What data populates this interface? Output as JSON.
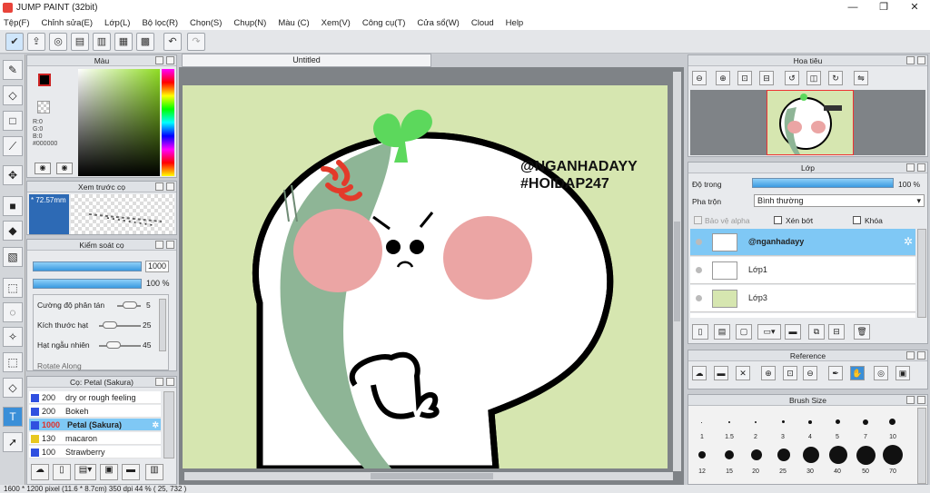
{
  "window": {
    "title": "JUMP PAINT (32bit)",
    "minimize": "—",
    "maximize": "❐",
    "close": "✕"
  },
  "menu": [
    "Tệp(F)",
    "Chỉnh sửa(E)",
    "Lớp(L)",
    "Bộ lọc(R)",
    "Chọn(S)",
    "Chụp(N)",
    "Màu (C)",
    "Xem(V)",
    "Công cụ(T)",
    "Cửa sổ(W)",
    "Cloud",
    "Help"
  ],
  "toolbar_icons": [
    "check-icon",
    "export-icon",
    "chat-icon",
    "comment-icon",
    "page-icon",
    "layout-icon",
    "grid-icon",
    "undo-icon",
    "redo-icon"
  ],
  "color_panel": {
    "title": "Màu",
    "r": "R:0",
    "g": "G:0",
    "b": "B:0",
    "hex": "#000000",
    "primary_color": "#000000",
    "secondary_color": "#ffffff"
  },
  "brush_preview": {
    "title": "Xem trước cọ",
    "size": "* 72.57mm"
  },
  "brush_control": {
    "title": "Kiểm soát cọ",
    "size_value": "1000",
    "opacity_value": "100 %",
    "scatter_label": "Cường độ phân tán",
    "scatter_value": "5",
    "grain_size_label": "Kích thước hạt",
    "grain_size_value": "25",
    "grain_random_label": "Hạt ngẫu nhiên",
    "grain_random_value": "45",
    "cutoff_label": "Rotate Along"
  },
  "brush_list": {
    "title": "Cọ: Petal (Sakura)",
    "items": [
      {
        "size": "200",
        "name": "dry or rough feeling",
        "color": "#3050e0"
      },
      {
        "size": "200",
        "name": "Bokeh",
        "color": "#3050e0"
      },
      {
        "size": "1000",
        "name": "Petal (Sakura)",
        "color": "#3050e0",
        "selected": true
      },
      {
        "size": "130",
        "name": "macaron",
        "color": "#e8c820"
      },
      {
        "size": "100",
        "name": "Strawberry",
        "color": "#3050e0"
      }
    ]
  },
  "document": {
    "tab_title": "Untitled",
    "watermark_line1": "@NGANHADAYY",
    "watermark_line2": "#HOIDAP247"
  },
  "navigator": {
    "title": "Hoa tiêu"
  },
  "layers_panel": {
    "title": "Lớp",
    "opacity_label": "Độ trong",
    "opacity_value": "100 %",
    "blend_label": "Pha trộn",
    "blend_value": "Bình thường",
    "protect_alpha": "Bảo vệ alpha",
    "clipping": "Xén bớt",
    "lock": "Khóa",
    "layers": [
      {
        "name": "@nganhadayy",
        "selected": true
      },
      {
        "name": "Lớp1",
        "selected": false
      },
      {
        "name": "Lớp3",
        "selected": false
      }
    ]
  },
  "reference_panel": {
    "title": "Reference"
  },
  "brush_size_panel": {
    "title": "Brush Size",
    "sizes_row1": [
      "1",
      "1.5",
      "2",
      "3",
      "4",
      "5",
      "7",
      "10"
    ],
    "sizes_row2": [
      "12",
      "15",
      "20",
      "25",
      "30",
      "40",
      "50",
      "70"
    ]
  },
  "status": "1600 * 1200 pixel  (11.6 * 8.7cm)  350 dpi  44 %  ( 25, 732 )",
  "colors": {
    "accent": "#3a8fd8",
    "canvas_bg": "#d6e6b0",
    "sprout": "#5cd85c",
    "cheek": "#eba5a4",
    "shade": "#8eb596",
    "anger": "#e33a2a"
  }
}
